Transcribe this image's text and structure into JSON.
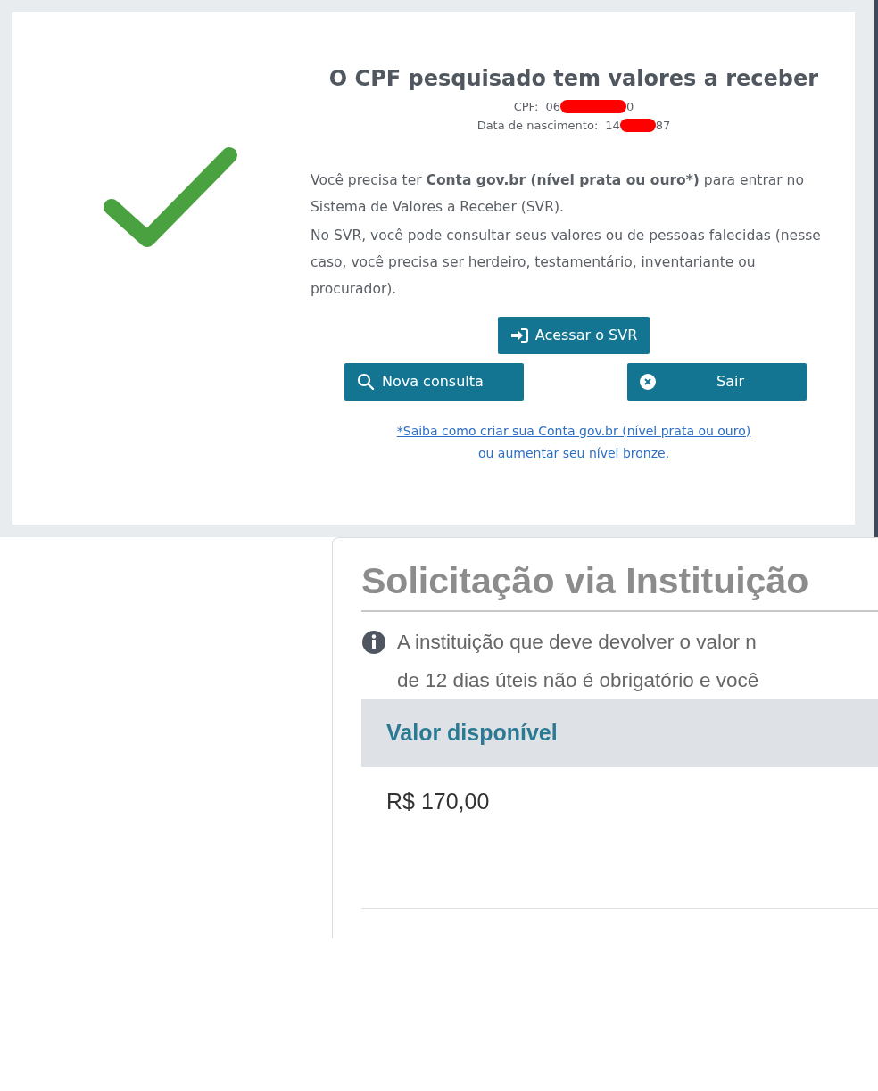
{
  "result": {
    "title": "O CPF pesquisado tem valores a receber",
    "cpf": {
      "label": "CPF:",
      "value_start": "06",
      "value_end": "0"
    },
    "birth_date": {
      "label": "Data de nascimento:",
      "value_start": "14",
      "value_end": "87"
    },
    "paragraphs": [
      "Você precisa ter **Conta gov.br (nível prata ou ouro*)** para entrar no Sistema de Valores a Receber (SVR).",
      "No SVR, você pode consultar seus valores ou de pessoas falecidas (nesse caso, você precisa ser herdeiro, testamentário, inventariante ou procurador)."
    ],
    "buttons": [
      {
        "label": "Acessar o SVR",
        "kind": "login"
      },
      {
        "label": "Nova consulta",
        "kind": "search"
      },
      {
        "label": "Sair",
        "kind": "exit"
      }
    ],
    "help_link_lines": [
      "*Saiba como criar sua Conta gov.br (nível prata ou ouro)",
      "ou aumentar seu nível bronze."
    ]
  },
  "request": {
    "title": "Solicitação via Instituição",
    "info_lines": [
      "A instituição que deve devolver o valor n",
      "de 12 dias úteis não é obrigatório e você"
    ],
    "table": {
      "columns": [
        "Valor disponível"
      ],
      "rows": [
        [
          "R$ 170,00"
        ]
      ]
    }
  }
}
